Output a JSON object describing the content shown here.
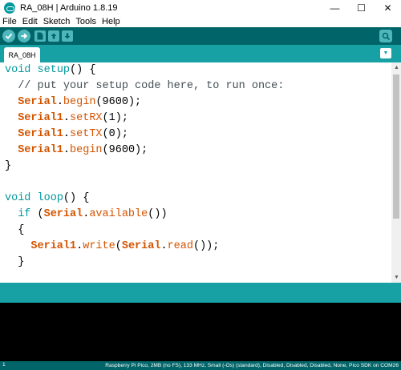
{
  "window": {
    "title": "RA_08H | Arduino 1.8.19",
    "minimize": "—",
    "maximize": "☐",
    "close": "✕"
  },
  "menu": [
    "File",
    "Edit",
    "Sketch",
    "Tools",
    "Help"
  ],
  "toolbar": {
    "buttons": [
      "verify-icon",
      "upload-icon",
      "new-icon",
      "open-icon",
      "save-icon"
    ],
    "right": "serial-monitor-icon"
  },
  "tabs": {
    "active": "RA_08H",
    "menu_icon": "▼"
  },
  "editor": {
    "lines": [
      [
        {
          "t": "void",
          "c": "kw"
        },
        {
          "t": " "
        },
        {
          "t": "setup",
          "c": "kw"
        },
        {
          "t": "() {"
        }
      ],
      [
        {
          "t": "  // put your setup code here, to run once:",
          "c": "cmt"
        }
      ],
      [
        {
          "t": "  "
        },
        {
          "t": "Serial",
          "c": "obj"
        },
        {
          "t": "."
        },
        {
          "t": "begin",
          "c": "fn"
        },
        {
          "t": "(9600);"
        }
      ],
      [
        {
          "t": "  "
        },
        {
          "t": "Serial1",
          "c": "obj"
        },
        {
          "t": "."
        },
        {
          "t": "setRX",
          "c": "fn"
        },
        {
          "t": "(1);"
        }
      ],
      [
        {
          "t": "  "
        },
        {
          "t": "Serial1",
          "c": "obj"
        },
        {
          "t": "."
        },
        {
          "t": "setTX",
          "c": "fn"
        },
        {
          "t": "(0);"
        }
      ],
      [
        {
          "t": "  "
        },
        {
          "t": "Serial1",
          "c": "obj"
        },
        {
          "t": "."
        },
        {
          "t": "begin",
          "c": "fn"
        },
        {
          "t": "(9600);"
        }
      ],
      [
        {
          "t": "}"
        }
      ],
      [
        {
          "t": ""
        }
      ],
      [
        {
          "t": "void",
          "c": "kw"
        },
        {
          "t": " "
        },
        {
          "t": "loop",
          "c": "kw"
        },
        {
          "t": "() {"
        }
      ],
      [
        {
          "t": "  "
        },
        {
          "t": "if",
          "c": "kw"
        },
        {
          "t": " ("
        },
        {
          "t": "Serial",
          "c": "obj"
        },
        {
          "t": "."
        },
        {
          "t": "available",
          "c": "fn"
        },
        {
          "t": "())"
        }
      ],
      [
        {
          "t": "  {"
        }
      ],
      [
        {
          "t": "    "
        },
        {
          "t": "Serial1",
          "c": "obj"
        },
        {
          "t": "."
        },
        {
          "t": "write",
          "c": "fn"
        },
        {
          "t": "("
        },
        {
          "t": "Serial",
          "c": "obj"
        },
        {
          "t": "."
        },
        {
          "t": "read",
          "c": "fn"
        },
        {
          "t": "());"
        }
      ],
      [
        {
          "t": "  }"
        }
      ]
    ]
  },
  "status": {
    "line": "1",
    "board": "Raspberry Pi Pico, 2MB (no FS), 133 MHz, Small (-Os) (standard), Disabled, Disabled, Disabled, None, Pico SDK on COM26"
  }
}
